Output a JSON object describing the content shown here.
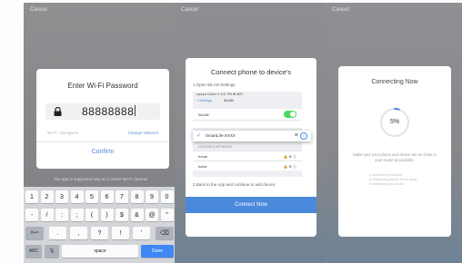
{
  "panel1": {
    "cancel": "Cancel",
    "dialog_title": "Enter Wi-Fi Password",
    "password_value": "88888888",
    "wifi_label": "Wi-Fi : Meogeme",
    "change_network": "Change Network",
    "confirm": "Confirm",
    "hint": "The app is supported only on 2.4GHz Wi-Fi channel",
    "keyboard": {
      "row1": [
        "1",
        "2",
        "3",
        "4",
        "5",
        "6",
        "7",
        "8",
        "9",
        "0"
      ],
      "row2": [
        "-",
        "/",
        ":",
        ";",
        "(",
        ")",
        "$",
        "&",
        "@",
        "\""
      ],
      "row3_left": "#+=",
      "row3": [
        ".",
        ",",
        "?",
        "!",
        "'"
      ],
      "row3_right": "⌫",
      "row4_abc": "ABC",
      "row4_mic": "🎙",
      "row4_space": "space",
      "row4_done": "Done"
    }
  },
  "panel2": {
    "cancel": "Cancel",
    "title": "Connect phone to device's",
    "step1": "1.Open WLAN Settings",
    "mock": {
      "status": "●●●●● Carrier  ▾     4:41 PM     ✱ 85%",
      "back": "< Settings",
      "header": "WLAN",
      "wlan_label": "WLAN",
      "choose": "CHOOSE A NETWORK...",
      "networks": [
        "home",
        "tuewi"
      ]
    },
    "selected_network": "SmartLife-XXXX",
    "step2": "2.Back to the App and continue to add device",
    "connect_now": "Connect Now"
  },
  "panel3": {
    "cancel": "Cancel",
    "title": "Connecting Now",
    "progress_text": "5%",
    "progress_fraction": 0.05,
    "description": "Make sure your phone and device are as close to your router as possible.",
    "steps": [
      "● Searching for Device",
      "● Registering device to the cloud",
      "● Initializing your device"
    ]
  },
  "colors": {
    "accent": "#4a89dc",
    "toggle_on": "#4cd964",
    "key_done": "#3f87f5"
  }
}
